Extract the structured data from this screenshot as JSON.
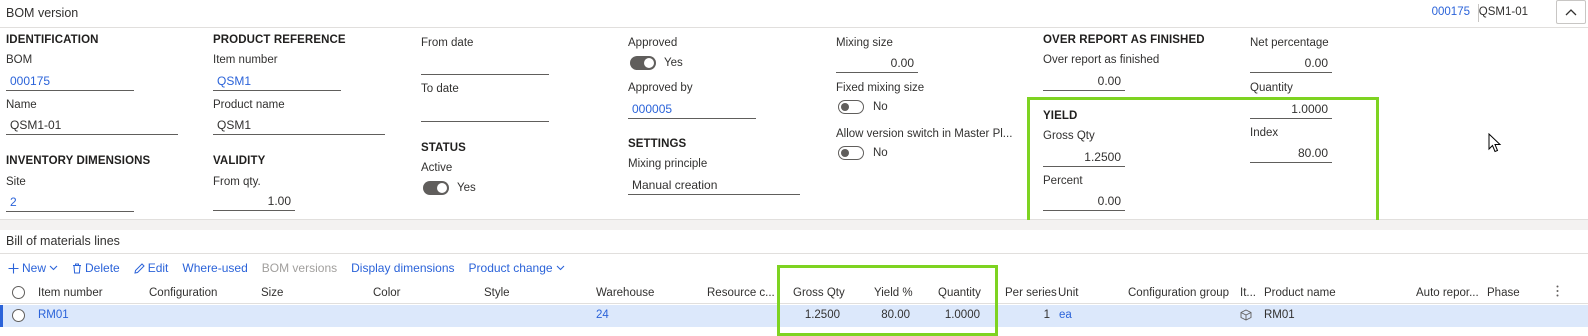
{
  "title_bar": {
    "title": "BOM version",
    "record_id": "000175",
    "record_name": "QSM1-01"
  },
  "identification": {
    "heading": "IDENTIFICATION",
    "bom_label": "BOM",
    "bom_value": "000175",
    "name_label": "Name",
    "name_value": "QSM1-01"
  },
  "inventory_dimensions": {
    "heading": "INVENTORY DIMENSIONS",
    "site_label": "Site",
    "site_value": "2"
  },
  "product_reference": {
    "heading": "PRODUCT REFERENCE",
    "item_number_label": "Item number",
    "item_number_value": "QSM1",
    "product_name_label": "Product name",
    "product_name_value": "QSM1"
  },
  "validity": {
    "heading": "VALIDITY",
    "from_qty_label": "From qty.",
    "from_qty_value": "1.00"
  },
  "dates": {
    "from_date_label": "From date",
    "to_date_label": "To date"
  },
  "status": {
    "heading": "STATUS",
    "active_label": "Active",
    "active_value": "Yes"
  },
  "approval": {
    "approved_label": "Approved",
    "approved_value": "Yes",
    "approved_by_label": "Approved by",
    "approved_by_value": "000005"
  },
  "settings": {
    "heading": "SETTINGS",
    "mixing_principle_label": "Mixing principle",
    "mixing_principle_value": "Manual creation"
  },
  "mixing": {
    "mixing_size_label": "Mixing size",
    "mixing_size_value": "0.00",
    "fixed_mixing_label": "Fixed mixing size",
    "fixed_mixing_value": "No",
    "allow_switch_label": "Allow version switch in Master Pl...",
    "allow_switch_value": "No"
  },
  "over_report": {
    "heading": "OVER REPORT AS FINISHED",
    "label": "Over report as finished",
    "value": "0.00"
  },
  "net": {
    "net_percentage_label": "Net percentage",
    "net_percentage_value": "0.00",
    "quantity_label": "Quantity",
    "quantity_value": "1.0000"
  },
  "yield": {
    "heading": "YIELD",
    "gross_qty_label": "Gross Qty",
    "gross_qty_value": "1.2500",
    "percent_label": "Percent",
    "percent_value": "0.00",
    "index_label": "Index",
    "index_value": "80.00"
  },
  "lines": {
    "title": "Bill of materials lines",
    "toolbar": {
      "new": "New",
      "delete": "Delete",
      "edit": "Edit",
      "where_used": "Where-used",
      "bom_versions": "BOM versions",
      "display_dimensions": "Display dimensions",
      "product_change": "Product change"
    },
    "columns": {
      "item_number": "Item number",
      "configuration": "Configuration",
      "size": "Size",
      "color": "Color",
      "style": "Style",
      "warehouse": "Warehouse",
      "resource": "Resource c...",
      "gross_qty": "Gross Qty",
      "yield_pct": "Yield %",
      "quantity": "Quantity",
      "per_series": "Per series",
      "unit": "Unit",
      "config_group": "Configuration group",
      "it": "It...",
      "product_name": "Product name",
      "auto_report": "Auto repor...",
      "phase": "Phase"
    },
    "row": {
      "item_number": "RM01",
      "warehouse": "24",
      "gross_qty": "1.2500",
      "yield_pct": "80.00",
      "quantity": "1.0000",
      "per_series": "1",
      "unit": "ea",
      "product_name": "RM01"
    }
  },
  "colors": {
    "link": "#2b63d9",
    "highlight": "#7ed321",
    "row_selected": "#dce8fb"
  }
}
